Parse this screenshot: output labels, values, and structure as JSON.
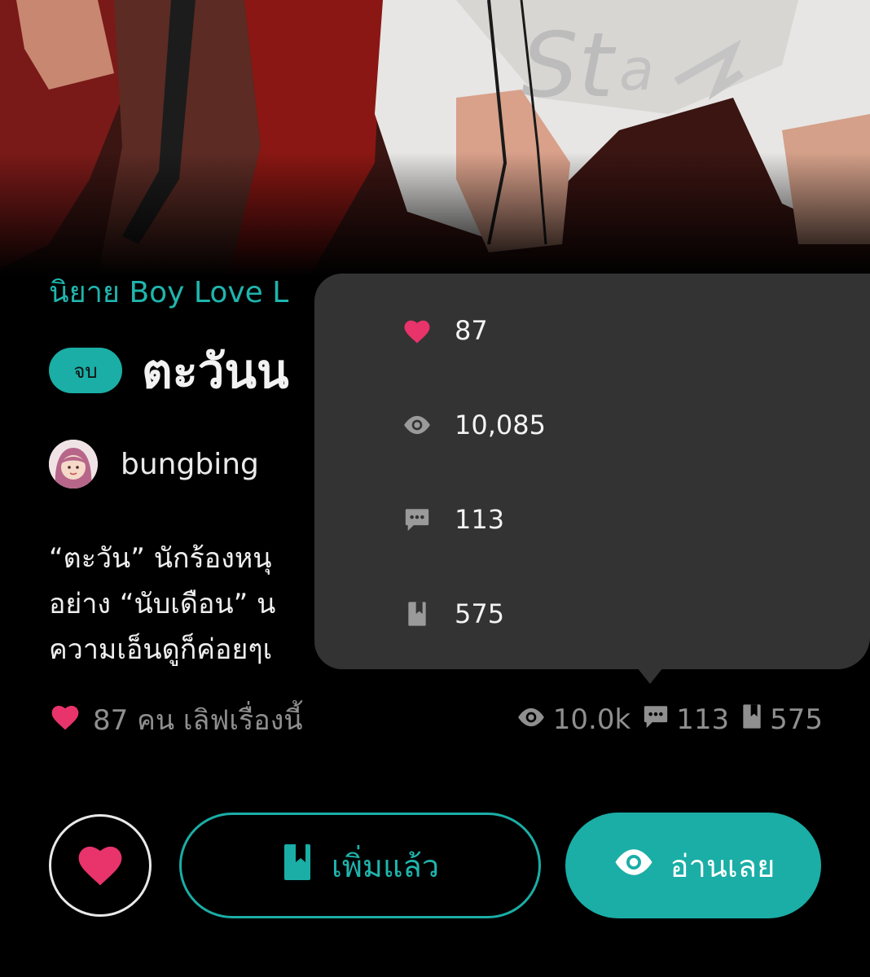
{
  "category": "นิยาย Boy Love L",
  "status_badge": "จบ",
  "title": "ตะวันน",
  "author": "bungbing",
  "description_lines": [
    "“ตะวัน” นักร้องหนุ",
    "อย่าง “นับเดือน” น",
    "ความเอ็นดูก็ค่อยๆเ"
  ],
  "stats": {
    "love_text": "87 คน เลิฟเรื่องนี้",
    "views_short": "10.0k",
    "comments": "113",
    "bookmarks": "575"
  },
  "popup": {
    "likes": "87",
    "views": "10,085",
    "comments": "113",
    "bookmarks": "575"
  },
  "actions": {
    "add_label": "เพิ่มแล้ว",
    "read_label": "อ่านเลย"
  },
  "colors": {
    "accent": "#1aaea6",
    "heart": "#e8336b",
    "popup_bg": "#333333"
  },
  "icons": {
    "heart": "heart-icon",
    "views": "eye-icon",
    "comments": "comment-icon",
    "bookmarks": "bookmark-icon"
  }
}
